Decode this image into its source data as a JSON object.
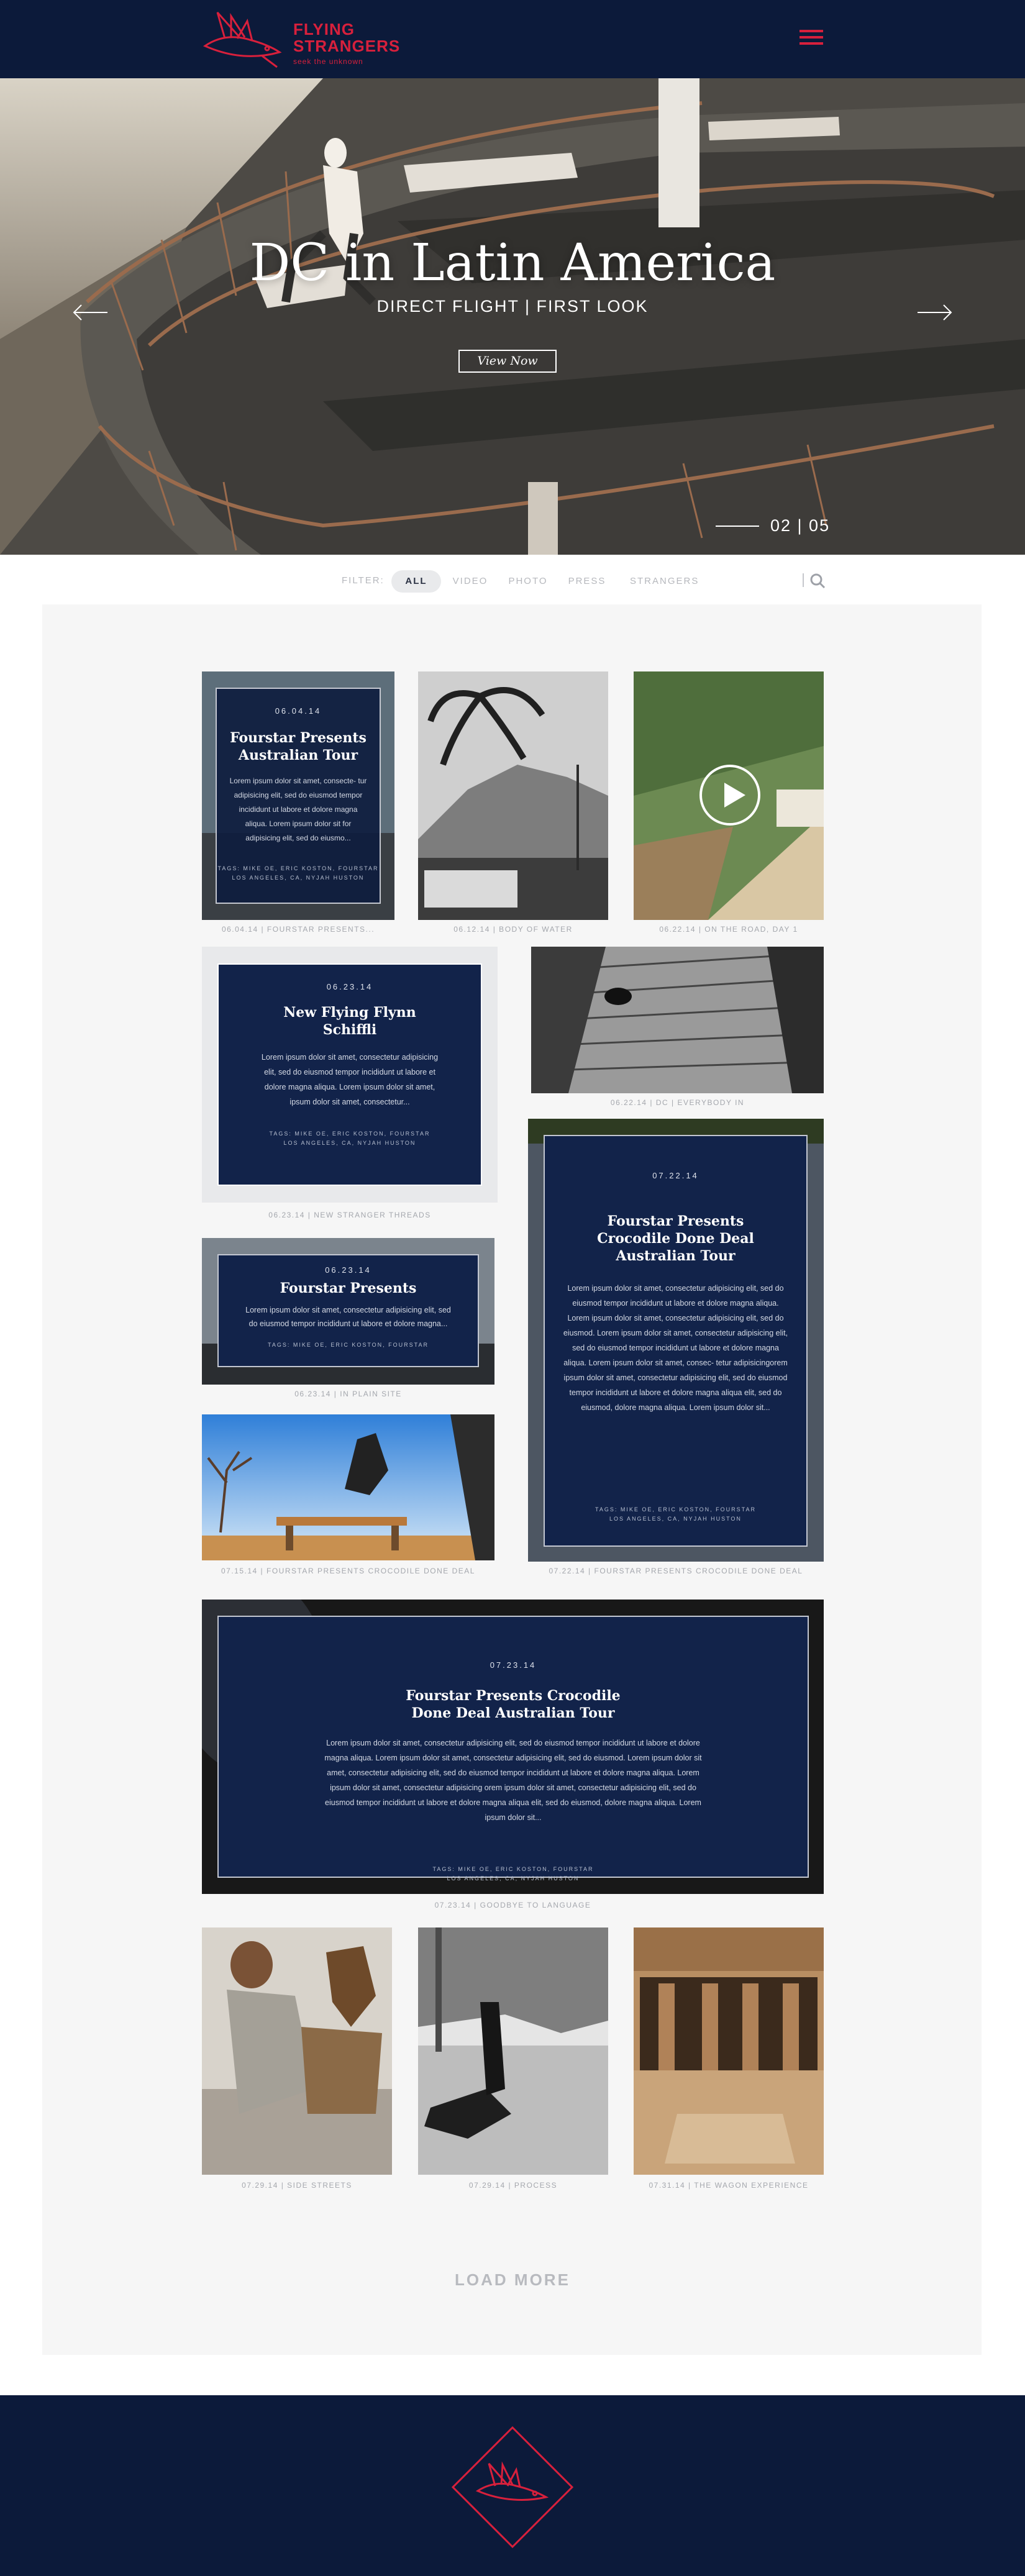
{
  "brand": {
    "title_line1": "FLYING",
    "title_line2": "STRANGERS",
    "tagline": "seek the unknown",
    "accent_color": "#d8203c",
    "navy_color": "#0c1a3a"
  },
  "header": {
    "menu_icon": "hamburger-icon"
  },
  "hero": {
    "title": "DC in Latin America",
    "subtitle": "DIRECT FLIGHT | FIRST LOOK",
    "button_label": "View Now",
    "pager": "02 | 05",
    "prev_icon": "arrow-left-icon",
    "next_icon": "arrow-right-icon"
  },
  "filter": {
    "label": "FILTER:",
    "options": [
      "ALL",
      "VIDEO",
      "PHOTO",
      "PRESS",
      "STRANGERS"
    ],
    "active": "ALL",
    "search_icon": "search-icon"
  },
  "cards": {
    "c1": {
      "date": "06.04.14",
      "title": "Fourstar Presents Australian Tour",
      "body": "Lorem ipsum dolor sit amet, consecte- tur adipisicing elit, sed do eiusmod tempor incididunt ut labore et dolore magna aliqua. Lorem ipsum dolor sit for adipisicing elit, sed do eiusmo...",
      "foot1": "TAGS: MIKE OE, ERIC KOSTON, FOURSTAR",
      "foot2": "LOS ANGELES, CA, NYJAH HUSTON",
      "caption": "06.04.14 | FOURSTAR PRESENTS..."
    },
    "c2": {
      "caption": "06.12.14 | BODY OF WATER"
    },
    "c3": {
      "caption": "06.22.14 | ON THE ROAD, DAY 1"
    },
    "c4": {
      "date": "06.23.14",
      "title": "New Flying Flynn Schiffli",
      "body": "Lorem ipsum dolor sit amet, consectetur adipisicing elit, sed do eiusmod tempor incididunt ut labore et dolore magna aliqua. Lorem ipsum dolor sit amet, ipsum dolor sit amet, consectetur...",
      "foot1": "TAGS: MIKE OE, ERIC KOSTON, FOURSTAR",
      "foot2": "LOS ANGELES, CA, NYJAH HUSTON",
      "caption": "06.23.14 | NEW STRANGER THREADS"
    },
    "c5": {
      "caption": "06.22.14 | DC | EVERYBODY IN"
    },
    "c6": {
      "date": "06.23.14",
      "title": "Fourstar Presents",
      "body": "Lorem ipsum dolor sit amet, consectetur adipisicing elit, sed do eiusmod tempor incididunt ut labore et dolore magna...",
      "foot1": "TAGS: MIKE OE, ERIC KOSTON, FOURSTAR",
      "caption": "06.23.14 | IN PLAIN SITE"
    },
    "c7": {
      "date": "07.22.14",
      "title": "Fourstar Presents Crocodile Done Deal Australian Tour",
      "body": "Lorem ipsum dolor sit amet, consectetur adipisicing elit, sed do eiusmod tempor incididunt ut labore et dolore magna aliqua. Lorem ipsum dolor sit amet, consectetur adipisicing elit, sed do eiusmod. Lorem ipsum dolor sit amet, consectetur adipisicing elit, sed do eiusmod tempor incididunt ut labore et dolore magna aliqua. Lorem ipsum dolor sit amet, consec- tetur adipisicingorem ipsum dolor sit amet, consectetur adipisicing elit, sed do eiusmod tempor incididunt ut labore et dolore magna aliqua elit, sed do eiusmod, dolore magna aliqua. Lorem ipsum dolor sit...",
      "foot1": "TAGS: MIKE OE, ERIC KOSTON, FOURSTAR",
      "foot2": "LOS ANGELES, CA, NYJAH HUSTON",
      "caption": "07.22.14 | FOURSTAR PRESENTS CROCODILE DONE DEAL"
    },
    "c8": {
      "caption": "07.15.14 | FOURSTAR PRESENTS CROCODILE DONE DEAL"
    },
    "c9": {
      "date": "07.23.14",
      "title": "Fourstar Presents Crocodile Done Deal Australian Tour",
      "body": "Lorem ipsum dolor sit amet, consectetur adipisicing elit, sed do eiusmod tempor incididunt ut labore et dolore magna aliqua. Lorem ipsum dolor sit amet, consectetur adipisicing elit, sed do eiusmod. Lorem ipsum dolor sit amet, consectetur adipisicing elit, sed do eiusmod tempor incididunt ut labore et dolore magna aliqua. Lorem ipsum dolor sit amet, consectetur adipisicing orem ipsum dolor sit amet, consectetur adipisicing elit, sed do eiusmod tempor incididunt ut labore et dolore magna aliqua elit, sed do eiusmod, dolore magna aliqua. Lorem ipsum dolor sit...",
      "foot1": "TAGS: MIKE OE, ERIC KOSTON, FOURSTAR",
      "foot2": "LOS ANGELES, CA, NYJAH HUSTON",
      "caption": "07.23.14 | GOODBYE TO LANGUAGE"
    },
    "c10": {
      "caption": "07.29.14 | SIDE STREETS"
    },
    "c11": {
      "caption": "07.29.14 | PROCESS"
    },
    "c12": {
      "caption": "07.31.14 | THE WAGON EXPERIENCE"
    }
  },
  "load_more": "LOAD MORE",
  "footer": {
    "logo_icon": "flying-fish-diamond-logo"
  }
}
